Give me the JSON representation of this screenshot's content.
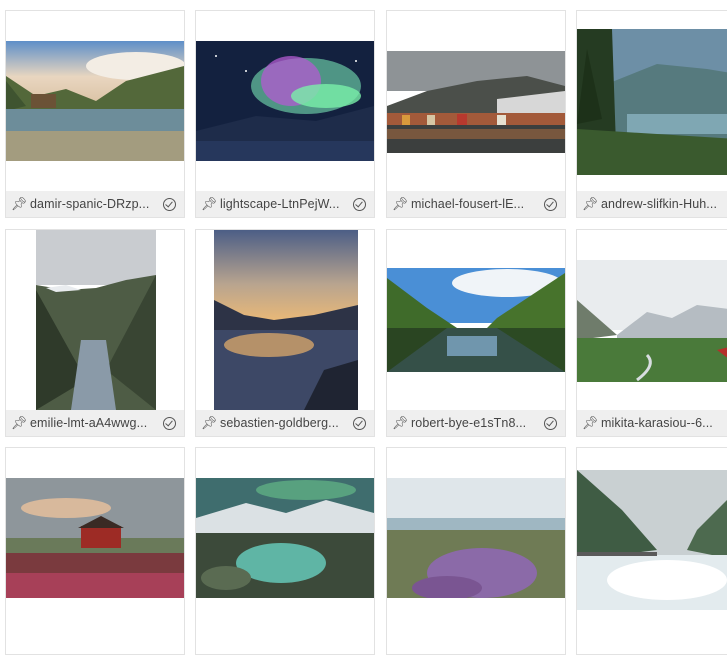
{
  "gallery": {
    "items": [
      {
        "filename": "damir-spanic-DRzp...",
        "selected": true
      },
      {
        "filename": "lightscape-LtnPejW...",
        "selected": true
      },
      {
        "filename": "michael-fousert-lE...",
        "selected": true
      },
      {
        "filename": "andrew-slifkin-Huh...",
        "selected": false
      },
      {
        "filename": "emilie-lmt-aA4wwg...",
        "selected": true
      },
      {
        "filename": "sebastien-goldberg...",
        "selected": true
      },
      {
        "filename": "robert-bye-e1sTn8...",
        "selected": true
      },
      {
        "filename": "mikita-karasiou--6...",
        "selected": false
      },
      {
        "filename": "",
        "selected": false
      },
      {
        "filename": "",
        "selected": false
      },
      {
        "filename": "",
        "selected": false
      },
      {
        "filename": "",
        "selected": false
      }
    ]
  }
}
